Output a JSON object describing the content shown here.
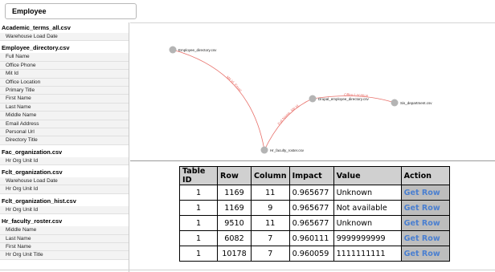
{
  "search": {
    "value": "Employee"
  },
  "left_panel": {
    "groups": [
      {
        "file": "Academic_terms_all.csv",
        "columns": [
          "Warehouse Load Date"
        ]
      },
      {
        "file": "Employee_directory.csv",
        "columns": [
          "Full Name",
          "Office Phone",
          "Mit Id",
          "Office Location",
          "Primary Title",
          "First Name",
          "Last Name",
          "Middle Name",
          "Email Address",
          "Personal Url",
          "Directory Title"
        ]
      },
      {
        "file": "Fac_organization.csv",
        "columns": [
          "Hr Org Unit Id"
        ]
      },
      {
        "file": "Fclt_organization.csv",
        "columns": [
          "Warehouse Load Date",
          "Hr Org Unit Id"
        ]
      },
      {
        "file": "Fclt_organization_hist.csv",
        "columns": [
          "Hr Org Unit Id"
        ]
      },
      {
        "file": "Hr_faculty_roster.csv",
        "columns": [
          "Middle Name",
          "Last Name",
          "First Name",
          "Hr Org Unit Title"
        ]
      }
    ]
  },
  "graph": {
    "nodes": [
      {
        "id": "n1",
        "label": "Employee_directory.csv"
      },
      {
        "id": "n2",
        "label": "Hr_faculty_roster.csv"
      },
      {
        "id": "n3",
        "label": "Drupal_employee_directory.csv"
      },
      {
        "id": "n4",
        "label": "Sis_department.csv"
      }
    ],
    "edges": [
      {
        "from": "n1",
        "to": "n2",
        "label": "Mit Id, Email"
      },
      {
        "from": "n2",
        "to": "n3",
        "label": "Full Name, Mit Id"
      },
      {
        "from": "n3",
        "to": "n4",
        "label": "Office Location"
      }
    ],
    "edge_color": "#e8706a",
    "node_color": "#b4b4b4"
  },
  "table": {
    "headers": [
      "Table ID",
      "Row",
      "Column",
      "Impact",
      "Value",
      "Action"
    ],
    "rows": [
      {
        "table_id": "1",
        "row": "1169",
        "column": "11",
        "impact": "0.965677",
        "value": "Unknown",
        "action": "Get Row"
      },
      {
        "table_id": "1",
        "row": "1169",
        "column": "9",
        "impact": "0.965677",
        "value": "Not available",
        "action": "Get Row"
      },
      {
        "table_id": "1",
        "row": "9510",
        "column": "11",
        "impact": "0.965677",
        "value": "Unknown",
        "action": "Get Row"
      },
      {
        "table_id": "1",
        "row": "6082",
        "column": "7",
        "impact": "0.960111",
        "value": "9999999999",
        "action": "Get Row"
      },
      {
        "table_id": "1",
        "row": "10178",
        "column": "7",
        "impact": "0.960059",
        "value": "1111111111",
        "action": "Get Row"
      }
    ]
  }
}
